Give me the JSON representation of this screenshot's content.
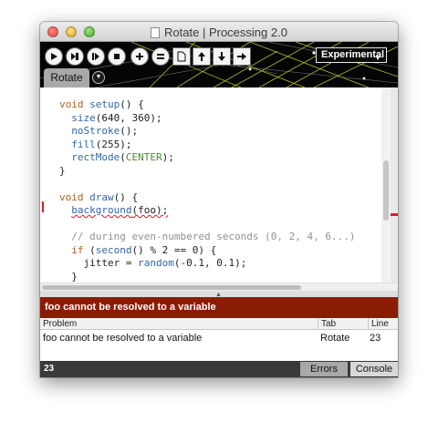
{
  "window": {
    "title": "Rotate | Processing 2.0"
  },
  "toolbar": {
    "buttons": [
      "run-icon",
      "present-icon",
      "step-icon",
      "stop-icon",
      "add-icon",
      "equals-icon",
      "new-icon",
      "open-icon",
      "save-icon",
      "export-icon"
    ],
    "mode_label": "Experimental"
  },
  "tabs": [
    {
      "label": "Rotate",
      "active": true
    }
  ],
  "editor": {
    "lines": [
      "void setup() {",
      "  size(640, 360);",
      "  noStroke();",
      "  fill(255);",
      "  rectMode(CENTER);",
      "}",
      "",
      "void draw() {",
      "  background(foo);",
      "",
      "  // during even-numbered seconds (0, 2, 4, 6...)",
      "  if (second() % 2 == 0) {",
      "    jitter = random(-0.1, 0.1);",
      "  }"
    ],
    "error_line_index": 8
  },
  "status": {
    "message": "foo cannot be resolved to a variable",
    "color": "#8b1c04"
  },
  "problems": {
    "headers": [
      "Problem",
      "Tab",
      "Line"
    ],
    "rows": [
      {
        "problem": "foo cannot be resolved to a variable",
        "tab": "Rotate",
        "line": "23"
      }
    ]
  },
  "footer": {
    "line_number": "23",
    "tabs": [
      "Errors",
      "Console"
    ],
    "active_tab": "Errors"
  }
}
